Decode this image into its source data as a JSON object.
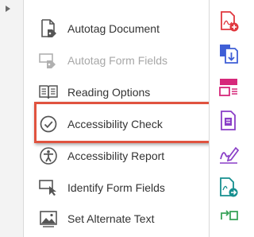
{
  "tools_panel": {
    "items": [
      {
        "label": "Autotag Document",
        "enabled": true,
        "icon": "autotag-document-icon"
      },
      {
        "label": "Autotag Form Fields",
        "enabled": false,
        "icon": "autotag-form-fields-icon"
      },
      {
        "label": "Reading Options",
        "enabled": true,
        "icon": "reading-options-icon"
      },
      {
        "label": "Accessibility Check",
        "enabled": true,
        "icon": "accessibility-check-icon",
        "highlighted": true
      },
      {
        "label": "Accessibility Report",
        "enabled": true,
        "icon": "accessibility-report-icon"
      },
      {
        "label": "Identify Form Fields",
        "enabled": true,
        "icon": "identify-form-fields-icon"
      },
      {
        "label": "Set Alternate Text",
        "enabled": true,
        "icon": "set-alternate-text-icon"
      }
    ]
  },
  "right_rail": {
    "icons": [
      "create-pdf-icon",
      "export-pdf-icon",
      "organize-pages-icon",
      "edit-pdf-icon",
      "fill-sign-icon",
      "send-for-review-icon",
      "compare-files-icon"
    ]
  },
  "colors": {
    "highlight": "#e0533f",
    "icon_gray": "#555555",
    "disabled_text": "#a7a7a7",
    "rail_red": "#e0373e",
    "rail_blue": "#3f5fd6",
    "rail_magenta": "#d6287a",
    "rail_purple": "#8a3fc7",
    "rail_teal": "#168f8f",
    "rail_green": "#3aa35a"
  }
}
